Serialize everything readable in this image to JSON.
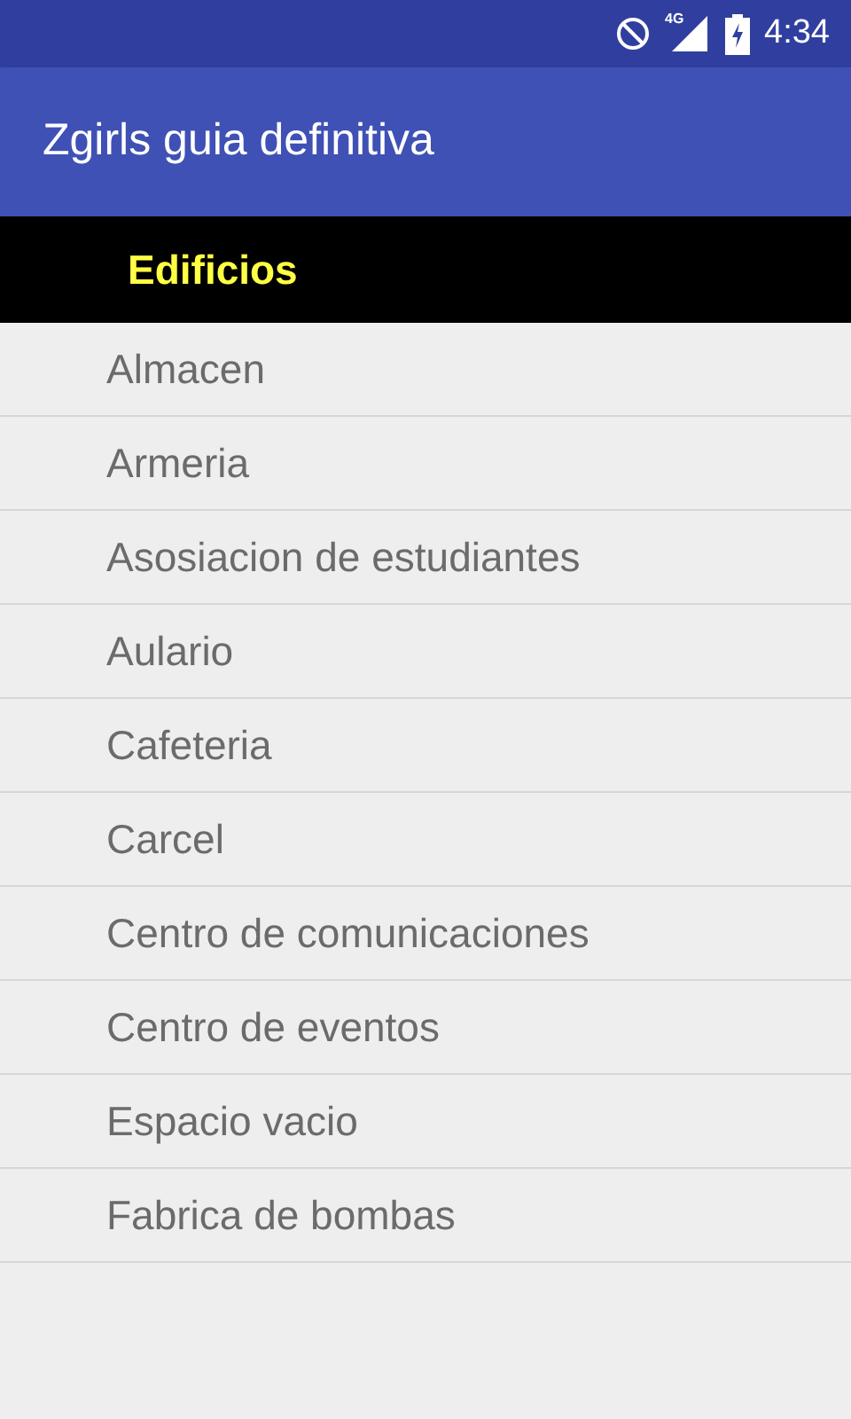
{
  "status_bar": {
    "network": "4G",
    "time": "4:34"
  },
  "app_bar": {
    "title": "Zgirls guia definitiva"
  },
  "section_header": {
    "title": "Edificios"
  },
  "items": [
    "Almacen",
    "Armeria",
    "Asosiacion de estudiantes",
    "Aulario",
    "Cafeteria",
    "Carcel",
    "Centro de comunicaciones",
    "Centro de eventos",
    "Espacio vacio",
    "Fabrica de bombas"
  ]
}
